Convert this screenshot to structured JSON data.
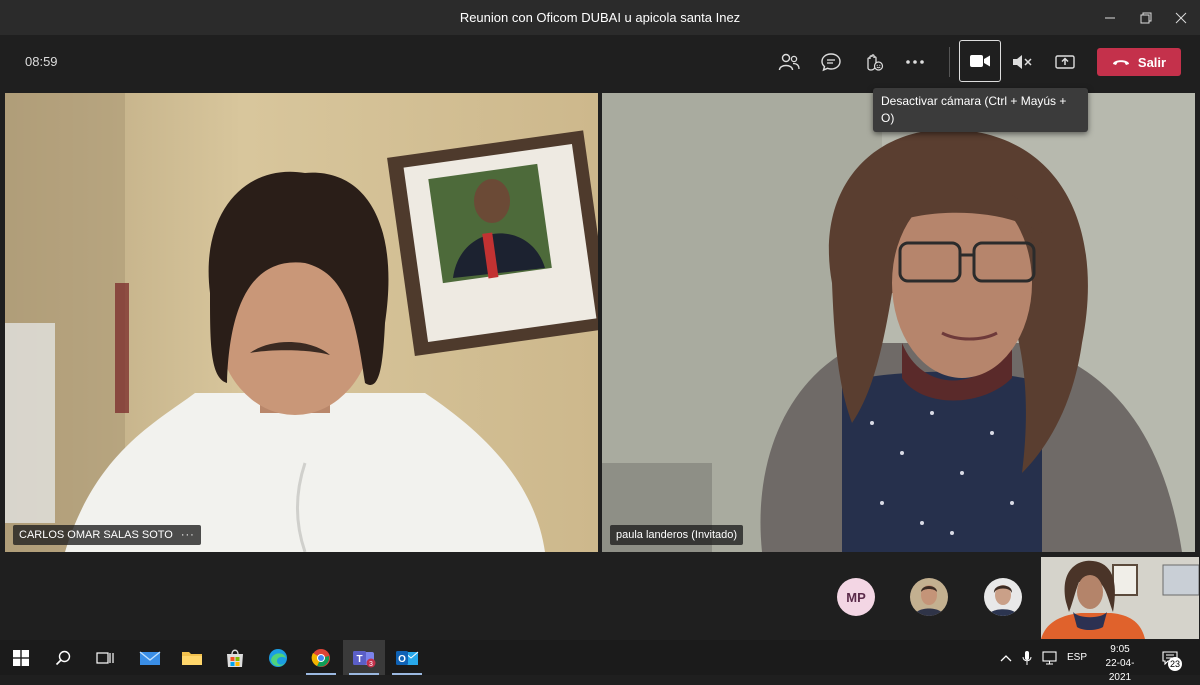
{
  "window": {
    "title": "Reunion con Oficom DUBAI u apicola santa Inez"
  },
  "toolbar": {
    "timer": "08:59",
    "leave_label": "Salir",
    "tooltip": "Desactivar cámara (Ctrl + Mayús + O)",
    "icons": [
      "people-icon",
      "chat-icon",
      "raise-hand-icon",
      "more-icon",
      "camera-icon",
      "mic-off-icon",
      "share-screen-icon",
      "phone-hangup-icon"
    ]
  },
  "videos": {
    "left_name": "CARLOS OMAR SALAS SOTO",
    "left_more": "···",
    "right_name": "paula landeros (Invitado)"
  },
  "participants": {
    "initials": "MP"
  },
  "taskbar": {
    "language": "ESP",
    "time": "9:05",
    "date": "22-04-2021",
    "notifications": "23",
    "teams_badge": "3",
    "colors": {
      "teams": "#5b5fc7",
      "leave": "#c4314b"
    }
  }
}
